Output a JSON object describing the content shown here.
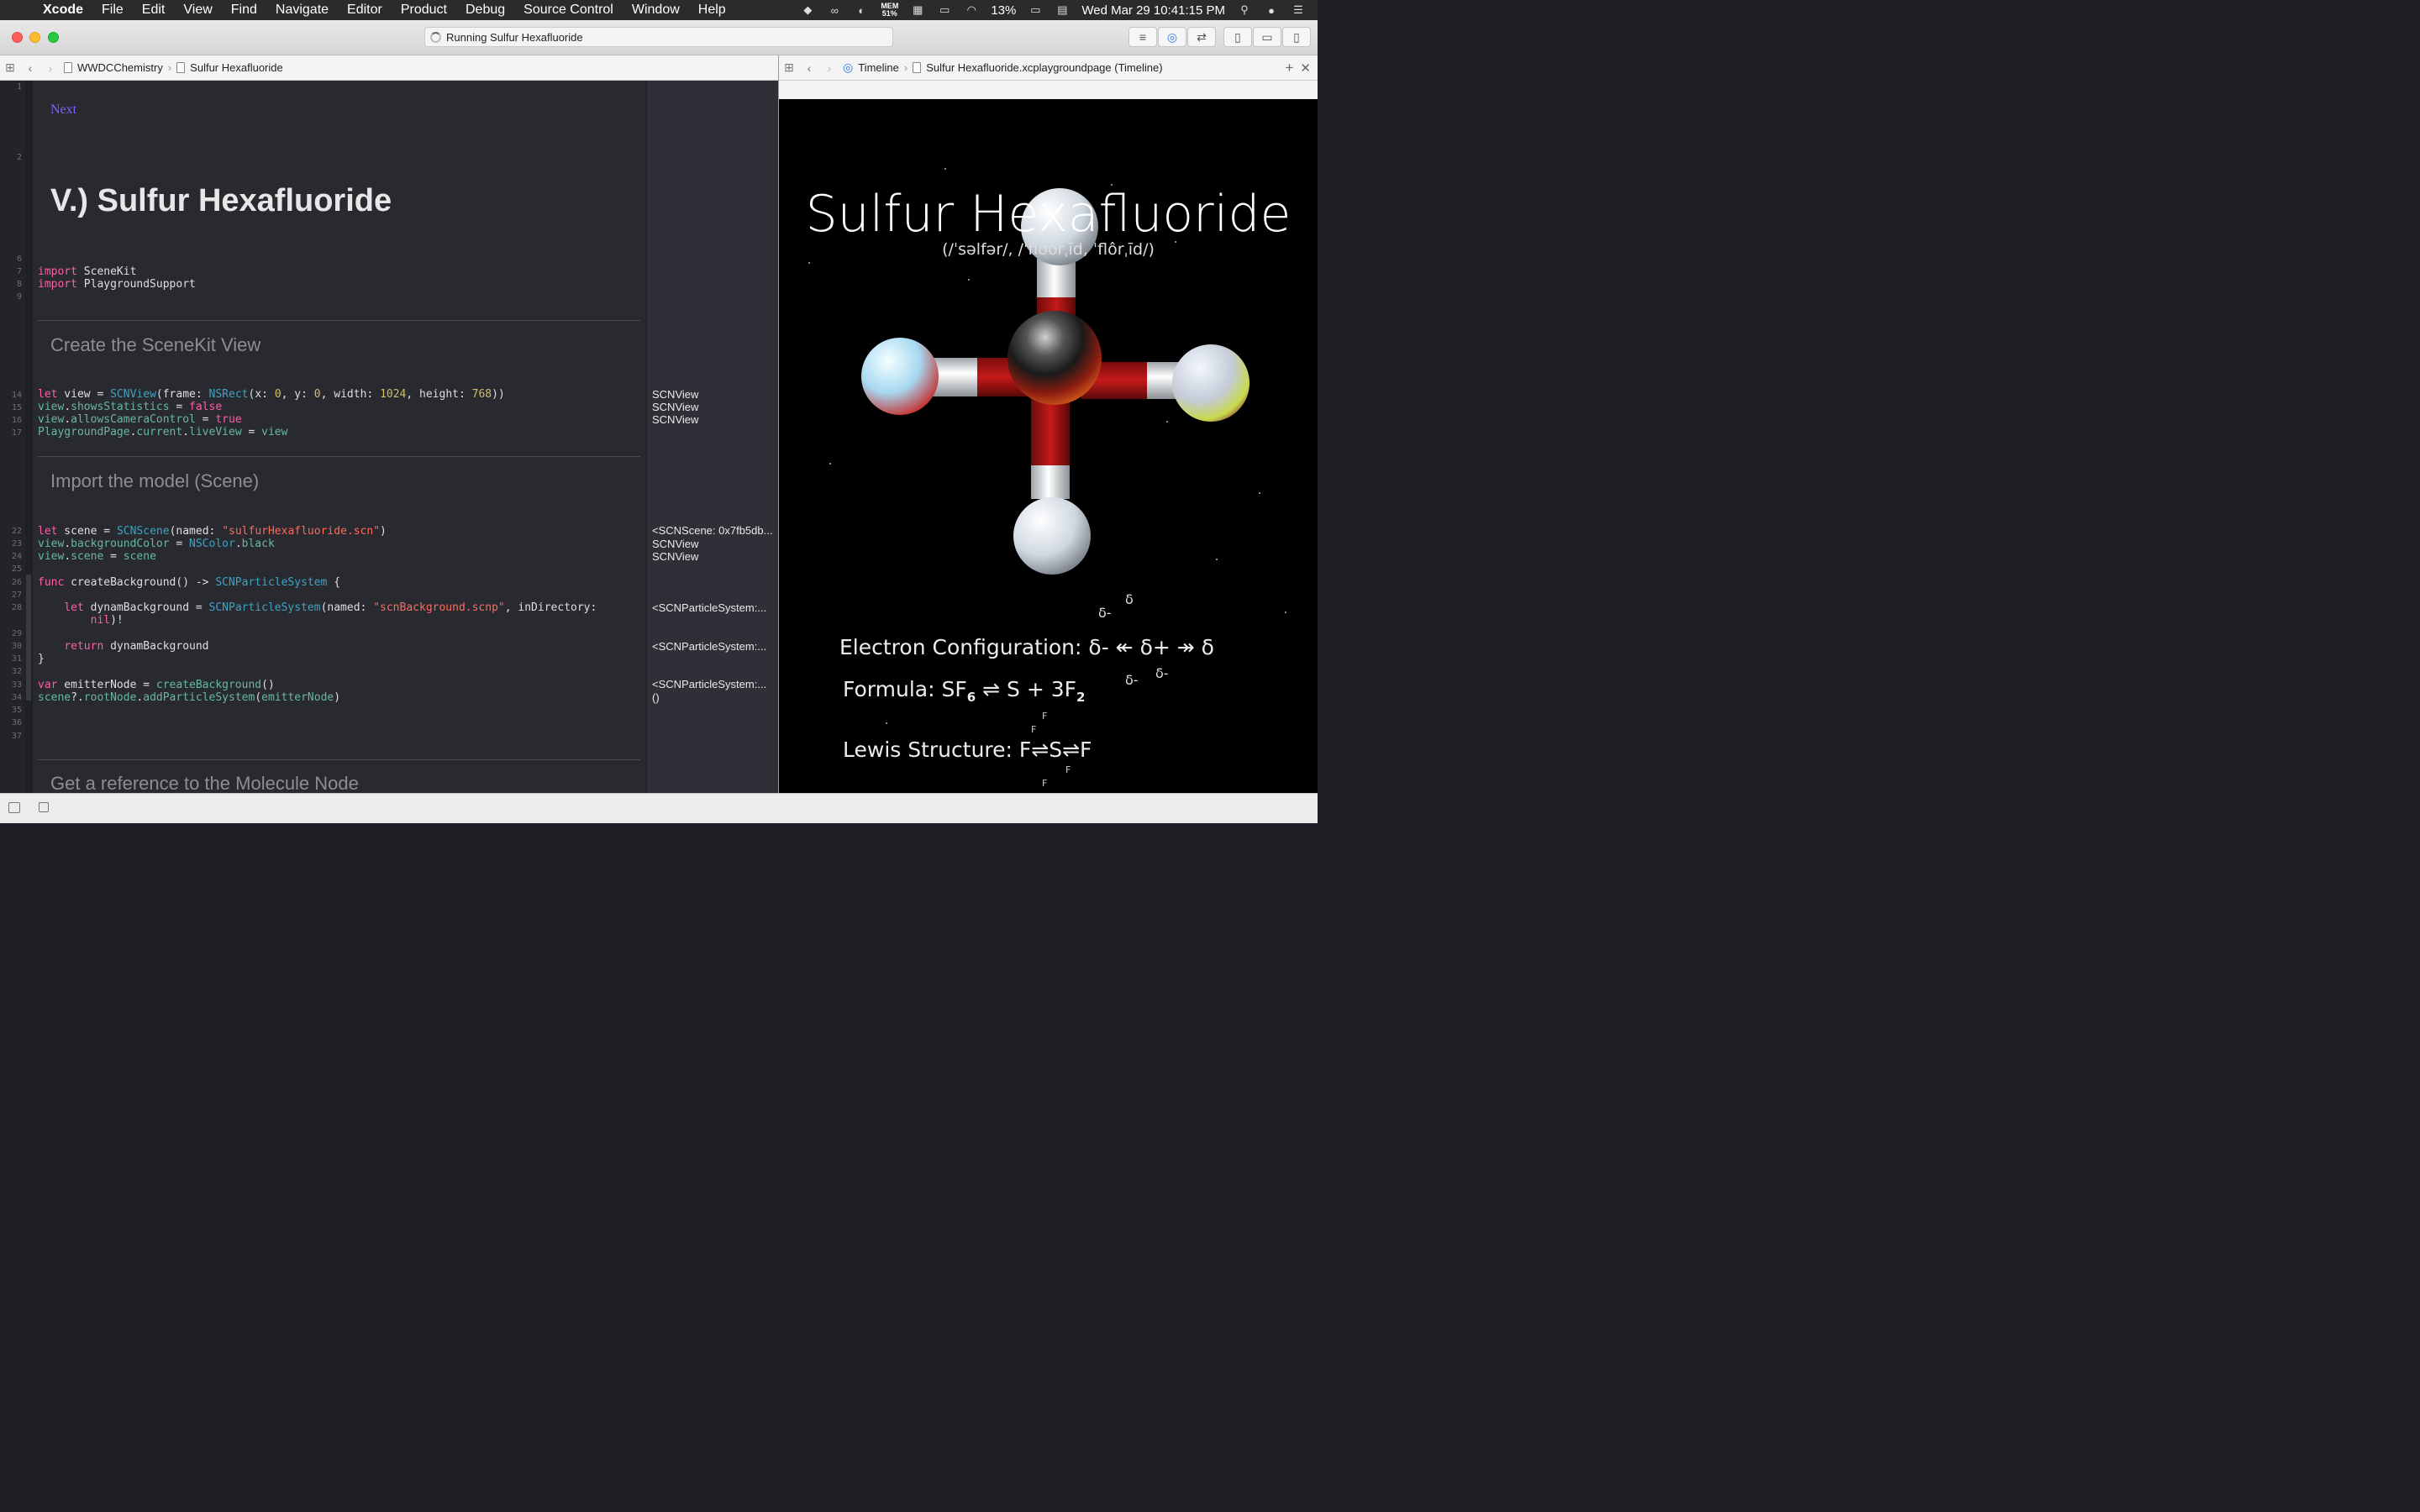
{
  "menubar": {
    "app_name": "Xcode",
    "items": [
      "File",
      "Edit",
      "View",
      "Find",
      "Navigate",
      "Editor",
      "Product",
      "Debug",
      "Source Control",
      "Window",
      "Help"
    ],
    "mem_label": "MEM",
    "mem_value": "51%",
    "battery": "13%",
    "datetime": "Wed Mar 29  10:41:15 PM",
    "icons": [
      "apple-icon",
      "dropbox-icon",
      "creative-cloud-icon",
      "sync-icon",
      "memory-icon",
      "keyboard-icon",
      "airplay-icon",
      "wifi-icon",
      "battery-icon",
      "calendar-icon",
      "spotlight-icon",
      "siri-icon",
      "notification-center-icon"
    ]
  },
  "toolbar": {
    "activity_status": "Running Sulfur Hexafluoride"
  },
  "left_jumpbar": {
    "crumbs": [
      "WWDCChemistry",
      "Sulfur Hexafluoride"
    ]
  },
  "right_jumpbar": {
    "crumbs": [
      "Timeline",
      "Sulfur Hexafluoride.xcplaygroundpage (Timeline)"
    ]
  },
  "editor": {
    "next_link": "Next",
    "heading": "V.) Sulfur Hexafluoride",
    "section1": "Create the SceneKit View",
    "section2": "Import the model (Scene)",
    "section3": "Get a reference to the Molecule Node",
    "line_numbers": {
      "l1": "1",
      "l2": "2",
      "l6": "6",
      "l7": "7",
      "l8": "8",
      "l9": "9",
      "l14": "14",
      "l15": "15",
      "l16": "16",
      "l17": "17",
      "l22": "22",
      "l23": "23",
      "l24": "24",
      "l25": "25",
      "l26": "26",
      "l27": "27",
      "l28": "28",
      "l29": "29",
      "l30": "30",
      "l31": "31",
      "l32": "32",
      "l33": "33",
      "l34": "34",
      "l35": "35",
      "l36": "36",
      "l37": "37"
    },
    "results": {
      "r14": "SCNView",
      "r15": "SCNView",
      "r16": "SCNView",
      "r22": "<SCNScene: 0x7fb5db...",
      "r23": "SCNView",
      "r24": "SCNView",
      "r28": "<SCNParticleSystem:...",
      "r30": "<SCNParticleSystem:...",
      "r33": "<SCNParticleSystem:...",
      "r34": "()"
    }
  },
  "liveview": {
    "title": "Sulfur Hexafluoride",
    "pronunciation": "(/ˈsəlfər/, /ˈflo͝orˌīd, ˈflôrˌīd/)",
    "electron_label": "Electron Configuration: ",
    "electron_value": "δ- ↞ δ+ ↠ δ",
    "formula_label": "Formula: SF",
    "formula_sub1": "6",
    "formula_mid": " ⇌ S + 3F",
    "formula_sub2": "2",
    "lewis_label": "Lewis Structure: F",
    "lewis_value": "⇌S⇌F",
    "delta_top": "δ",
    "delta_left": "δ-",
    "delta_bottom": "δ-",
    "delta_right": "δ-",
    "lewis_f": "F"
  }
}
